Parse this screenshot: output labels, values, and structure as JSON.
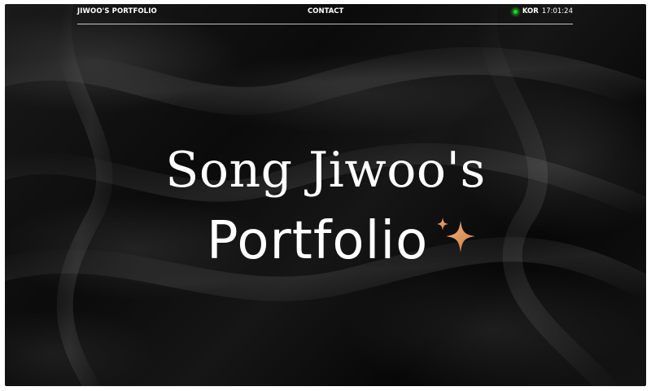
{
  "header": {
    "brand": "JIWOO'S PORTFOLIO",
    "nav_contact": "CONTACT",
    "region": "KOR",
    "clock": "17:01:24",
    "status_color": "#2bd12b"
  },
  "hero": {
    "line1": "Song Jiwoo's",
    "line2": "Portfolio",
    "sparkle_icon": "sparkles-icon",
    "sparkle_color": "#e09a62"
  },
  "background": {
    "style": "black silk",
    "base_color": "#0b0b0b"
  }
}
